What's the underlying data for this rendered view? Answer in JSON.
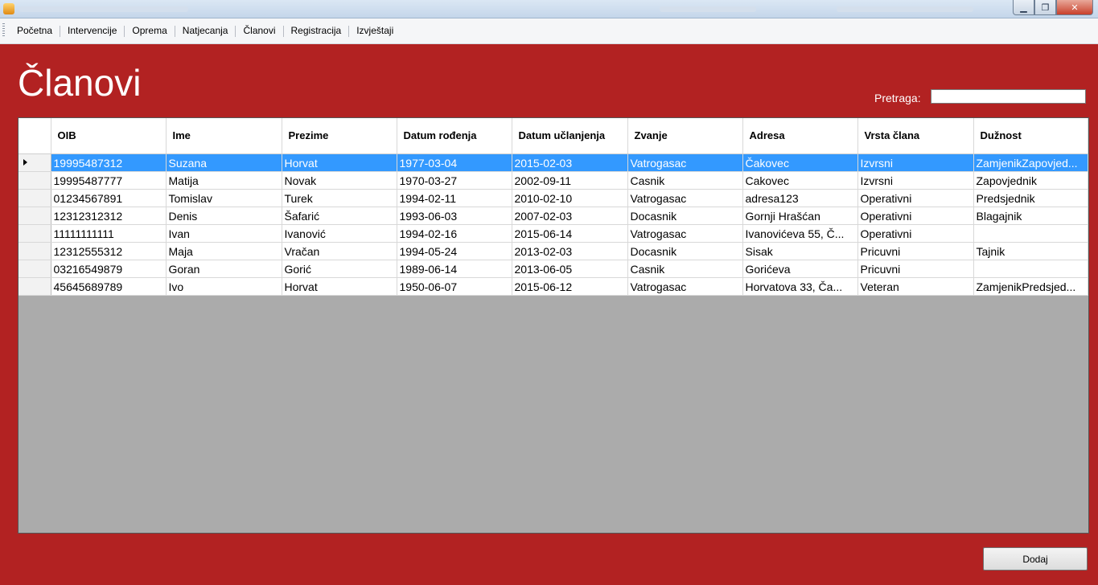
{
  "menu": {
    "items": [
      "Početna",
      "Intervencije",
      "Oprema",
      "Natjecanja",
      "Članovi",
      "Registracija",
      "Izvještaji"
    ]
  },
  "page": {
    "title": "Članovi",
    "search_label": "Pretraga:",
    "search_value": "",
    "add_button": "Dodaj"
  },
  "table": {
    "columns": [
      "OIB",
      "Ime",
      "Prezime",
      "Datum rođenja",
      "Datum učlanjenja",
      "Zvanje",
      "Adresa",
      "Vrsta člana",
      "Dužnost"
    ],
    "selected_row": 0,
    "rows": [
      [
        "19995487312",
        "Suzana",
        "Horvat",
        "1977-03-04",
        "2015-02-03",
        "Vatrogasac",
        "Čakovec",
        "Izvrsni",
        "ZamjenikZapovjed..."
      ],
      [
        "19995487777",
        "Matija",
        "Novak",
        "1970-03-27",
        "2002-09-11",
        "Casnik",
        "Cakovec",
        "Izvrsni",
        "Zapovjednik"
      ],
      [
        "01234567891",
        "Tomislav",
        "Turek",
        "1994-02-11",
        "2010-02-10",
        "Vatrogasac",
        "adresa123",
        "Operativni",
        "Predsjednik"
      ],
      [
        "12312312312",
        "Denis",
        "Šafarić",
        "1993-06-03",
        "2007-02-03",
        "Docasnik",
        "Gornji Hrašćan",
        "Operativni",
        "Blagajnik"
      ],
      [
        "11111111111",
        "Ivan",
        "Ivanović",
        "1994-02-16",
        "2015-06-14",
        "Vatrogasac",
        "Ivanovićeva 55, Č...",
        "Operativni",
        ""
      ],
      [
        "12312555312",
        "Maja",
        "Vračan",
        "1994-05-24",
        "2013-02-03",
        "Docasnik",
        "Sisak",
        "Pricuvni",
        "Tajnik"
      ],
      [
        "03216549879",
        "Goran",
        "Gorić",
        "1989-06-14",
        "2013-06-05",
        "Casnik",
        "Gorićeva",
        "Pricuvni",
        ""
      ],
      [
        "45645689789",
        "Ivo",
        "Horvat",
        "1950-06-07",
        "2015-06-12",
        "Vatrogasac",
        "Horvatova 33, Ča...",
        "Veteran",
        "ZamjenikPredsjed..."
      ]
    ]
  }
}
